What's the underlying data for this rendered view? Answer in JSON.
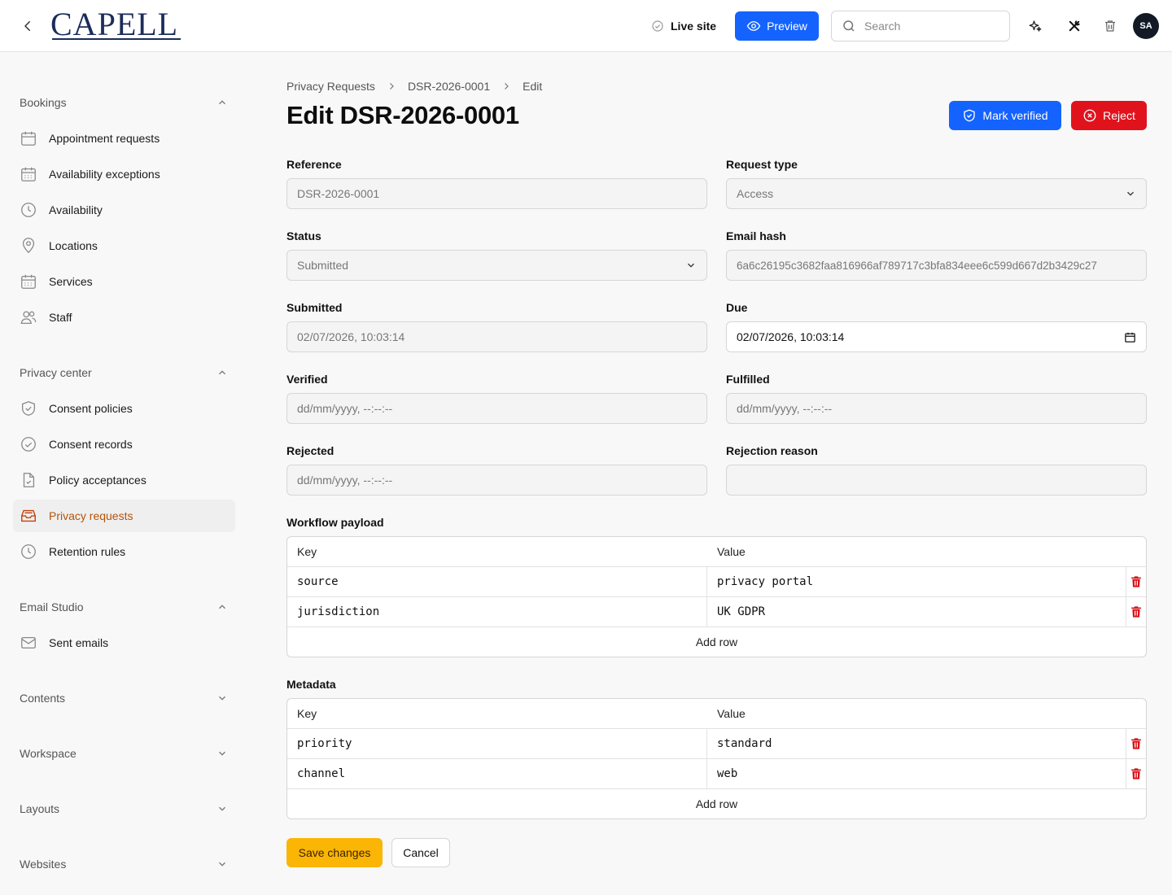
{
  "header": {
    "logo_text": "CAPELL",
    "live_site_label": "Live site",
    "preview_label": "Preview",
    "search_placeholder": "Search",
    "avatar_initials": "SA"
  },
  "sidebar": {
    "bookings": {
      "title": "Bookings",
      "items": [
        {
          "label": "Appointment requests",
          "icon": "calendar-icon"
        },
        {
          "label": "Availability exceptions",
          "icon": "calendar-grid-icon"
        },
        {
          "label": "Availability",
          "icon": "clock-icon"
        },
        {
          "label": "Locations",
          "icon": "map-pin-icon"
        },
        {
          "label": "Services",
          "icon": "calendar-grid-icon"
        },
        {
          "label": "Staff",
          "icon": "users-icon"
        }
      ]
    },
    "privacy": {
      "title": "Privacy center",
      "items": [
        {
          "label": "Consent policies",
          "icon": "shield-check-icon"
        },
        {
          "label": "Consent records",
          "icon": "check-circle-icon"
        },
        {
          "label": "Policy acceptances",
          "icon": "document-check-icon"
        },
        {
          "label": "Privacy requests",
          "icon": "inbox-icon",
          "active": true
        },
        {
          "label": "Retention rules",
          "icon": "clock-icon"
        }
      ]
    },
    "email": {
      "title": "Email Studio",
      "items": [
        {
          "label": "Sent emails",
          "icon": "envelope-icon"
        }
      ]
    },
    "contents": {
      "title": "Contents"
    },
    "workspace": {
      "title": "Workspace"
    },
    "layouts": {
      "title": "Layouts"
    },
    "websites": {
      "title": "Websites"
    }
  },
  "breadcrumb": [
    "Privacy Requests",
    "DSR-2026-0001",
    "Edit"
  ],
  "page": {
    "title": "Edit DSR-2026-0001",
    "mark_verified_label": "Mark verified",
    "reject_label": "Reject"
  },
  "form": {
    "reference": {
      "label": "Reference",
      "value": "DSR-2026-0001"
    },
    "request_type": {
      "label": "Request type",
      "value": "Access"
    },
    "status": {
      "label": "Status",
      "value": "Submitted"
    },
    "email_hash": {
      "label": "Email hash",
      "value": "6a6c26195c3682faa816966af789717c3bfa834eee6c599d667d2b3429c27"
    },
    "submitted": {
      "label": "Submitted",
      "value": "02/07/2026, 10:03:14"
    },
    "due": {
      "label": "Due",
      "value": "02/07/2026, 10:03:14"
    },
    "verified": {
      "label": "Verified",
      "placeholder": "dd/mm/yyyy, --:--:--"
    },
    "fulfilled": {
      "label": "Fulfilled",
      "placeholder": "dd/mm/yyyy, --:--:--"
    },
    "rejected": {
      "label": "Rejected",
      "placeholder": "dd/mm/yyyy, --:--:--"
    },
    "rejection_reason": {
      "label": "Rejection reason",
      "value": ""
    }
  },
  "workflow_payload": {
    "label": "Workflow payload",
    "key_header": "Key",
    "value_header": "Value",
    "rows": [
      {
        "key": "source",
        "value": "privacy portal"
      },
      {
        "key": "jurisdiction",
        "value": "UK GDPR"
      }
    ],
    "add_row_label": "Add row"
  },
  "metadata": {
    "label": "Metadata",
    "key_header": "Key",
    "value_header": "Value",
    "rows": [
      {
        "key": "priority",
        "value": "standard"
      },
      {
        "key": "channel",
        "value": "web"
      }
    ],
    "add_row_label": "Add row"
  },
  "actions": {
    "save_label": "Save changes",
    "cancel_label": "Cancel"
  },
  "colors": {
    "primary": "#1463ff",
    "danger": "#e0131d",
    "save": "#fbb505",
    "active_nav_text": "#b45309"
  }
}
